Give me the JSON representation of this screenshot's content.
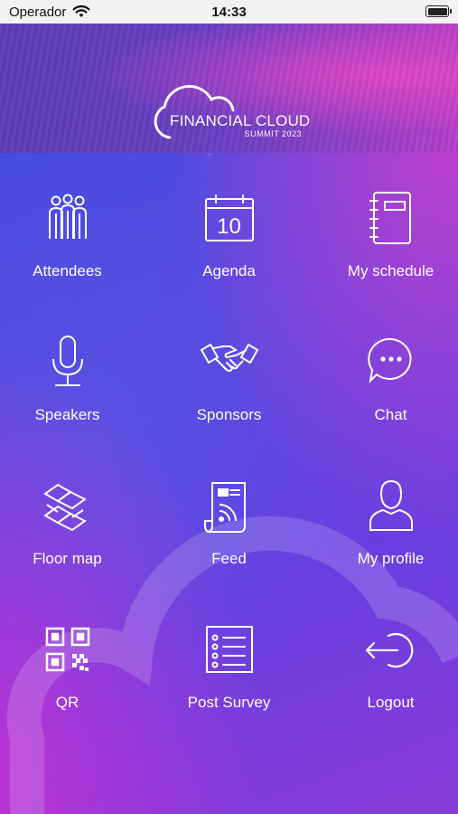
{
  "status_bar": {
    "carrier": "Operador",
    "time": "14:33"
  },
  "header": {
    "logo_title": "FINANCIAL CLOUD",
    "logo_subtitle": "SUMMIT 2023"
  },
  "menu": [
    {
      "label": "Attendees",
      "icon": "attendees-icon"
    },
    {
      "label": "Agenda",
      "icon": "calendar-icon",
      "day": "10"
    },
    {
      "label": "My schedule",
      "icon": "notebook-icon"
    },
    {
      "label": "Speakers",
      "icon": "microphone-icon"
    },
    {
      "label": "Sponsors",
      "icon": "handshake-icon"
    },
    {
      "label": "Chat",
      "icon": "chat-bubble-icon"
    },
    {
      "label": "Floor map",
      "icon": "floor-map-icon"
    },
    {
      "label": "Feed",
      "icon": "rss-scroll-icon"
    },
    {
      "label": "My profile",
      "icon": "user-icon"
    },
    {
      "label": "QR",
      "icon": "qr-code-icon"
    },
    {
      "label": "Post Survey",
      "icon": "survey-list-icon"
    },
    {
      "label": "Logout",
      "icon": "logout-icon"
    }
  ],
  "colors": {
    "primary": "#5a48e0",
    "accent": "#d23cc8",
    "status_bar": "#f2f2f2"
  }
}
